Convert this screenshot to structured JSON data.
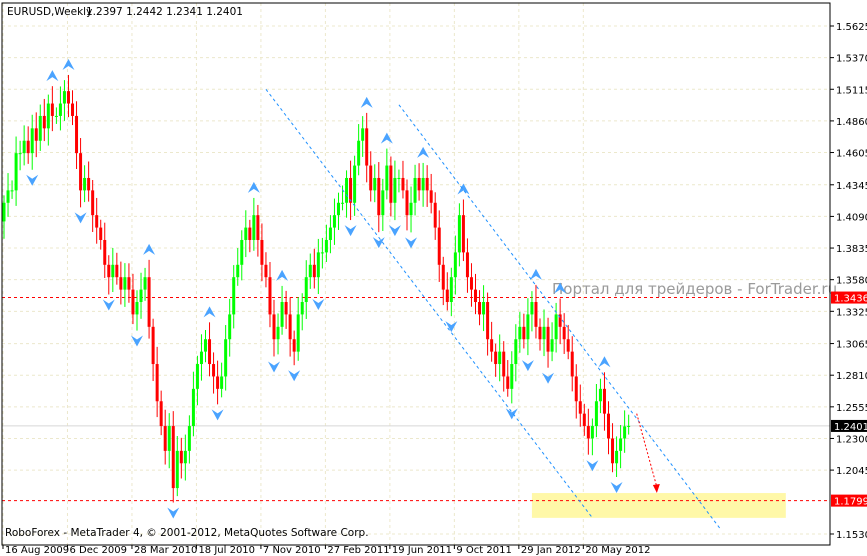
{
  "chart_data": {
    "type": "candlestick",
    "title": "EURUSD,Weekly",
    "ohlc_header": "1.2397 1.2442 1.2341 1.2401",
    "footer": "RoboForex - MetaTrader 4, © 2001-2012, MetaQuotes Software Corp.",
    "watermark": "Портал для трейдеров - ForTrader.ru",
    "ylim": [
      1.153,
      1.5625
    ],
    "y_ticks": [
      "1.5625",
      "1.5370",
      "1.5115",
      "1.4860",
      "1.4605",
      "1.4345",
      "1.4090",
      "1.3835",
      "1.3580",
      "1.3325",
      "1.3065",
      "1.2810",
      "1.2555",
      "1.2300",
      "1.2045",
      "1.1530"
    ],
    "x_ticks": [
      {
        "label": "16 Aug 2009",
        "week": 0
      },
      {
        "label": "6 Dec 2009",
        "week": 16
      },
      {
        "label": "28 Mar 2010",
        "week": 32
      },
      {
        "label": "18 Jul 2010",
        "week": 48
      },
      {
        "label": "7 Nov 2010",
        "week": 64
      },
      {
        "label": "27 Feb 2011",
        "week": 80
      },
      {
        "label": "19 Jun 2011",
        "week": 96
      },
      {
        "label": "9 Oct 2011",
        "week": 112
      },
      {
        "label": "29 Jan 2012",
        "week": 128
      },
      {
        "label": "20 May 2012",
        "week": 144
      }
    ],
    "first_open": 1.405,
    "weekly_closes": [
      1.42,
      1.43,
      1.43,
      1.46,
      1.46,
      1.47,
      1.46,
      1.48,
      1.47,
      1.49,
      1.48,
      1.5,
      1.49,
      1.49,
      1.5,
      1.51,
      1.5,
      1.49,
      1.46,
      1.43,
      1.44,
      1.43,
      1.41,
      1.4,
      1.39,
      1.37,
      1.36,
      1.37,
      1.36,
      1.35,
      1.36,
      1.35,
      1.33,
      1.34,
      1.35,
      1.36,
      1.32,
      1.29,
      1.26,
      1.24,
      1.22,
      1.24,
      1.19,
      1.22,
      1.21,
      1.22,
      1.24,
      1.27,
      1.29,
      1.3,
      1.31,
      1.29,
      1.28,
      1.27,
      1.28,
      1.31,
      1.33,
      1.36,
      1.37,
      1.39,
      1.4,
      1.39,
      1.41,
      1.39,
      1.37,
      1.36,
      1.33,
      1.31,
      1.32,
      1.34,
      1.33,
      1.31,
      1.3,
      1.33,
      1.34,
      1.36,
      1.37,
      1.36,
      1.38,
      1.38,
      1.39,
      1.4,
      1.41,
      1.42,
      1.42,
      1.44,
      1.42,
      1.45,
      1.47,
      1.48,
      1.45,
      1.43,
      1.44,
      1.41,
      1.43,
      1.45,
      1.42,
      1.44,
      1.44,
      1.43,
      1.41,
      1.42,
      1.44,
      1.43,
      1.44,
      1.43,
      1.42,
      1.4,
      1.37,
      1.35,
      1.34,
      1.36,
      1.38,
      1.41,
      1.38,
      1.36,
      1.35,
      1.34,
      1.33,
      1.34,
      1.31,
      1.3,
      1.29,
      1.3,
      1.28,
      1.27,
      1.29,
      1.31,
      1.32,
      1.31,
      1.33,
      1.34,
      1.32,
      1.31,
      1.32,
      1.3,
      1.31,
      1.33,
      1.32,
      1.31,
      1.3,
      1.28,
      1.26,
      1.25,
      1.24,
      1.23,
      1.24,
      1.26,
      1.27,
      1.25,
      1.23,
      1.21,
      1.22,
      1.23,
      1.2397,
      1.2401
    ],
    "levels": [
      {
        "price": 1.3436,
        "label": "1.3436",
        "color": "#ff0000"
      },
      {
        "price": 1.1799,
        "label": "1.1799",
        "color": "#ff0000"
      }
    ],
    "current_price": {
      "price": 1.2401,
      "label": "1.2401"
    },
    "target_zone": {
      "from_week": 131,
      "to_week": 194,
      "low": 1.166,
      "high": 1.186
    },
    "channel_lines": [
      {
        "w1": 65,
        "p1": 1.5115,
        "w2": 146,
        "p2": 1.166
      },
      {
        "w1": 98,
        "p1": 1.499,
        "w2": 178,
        "p2": 1.156
      }
    ],
    "forecast_arrow": {
      "w1": 157,
      "p1": 1.25,
      "w2": 162,
      "p2": 1.186
    },
    "colors": {
      "bull": "#00ff00",
      "bear": "#ff0000",
      "channel": "#1e90ff",
      "grid": "#ece8cc",
      "zone": "#fff8a8"
    }
  }
}
